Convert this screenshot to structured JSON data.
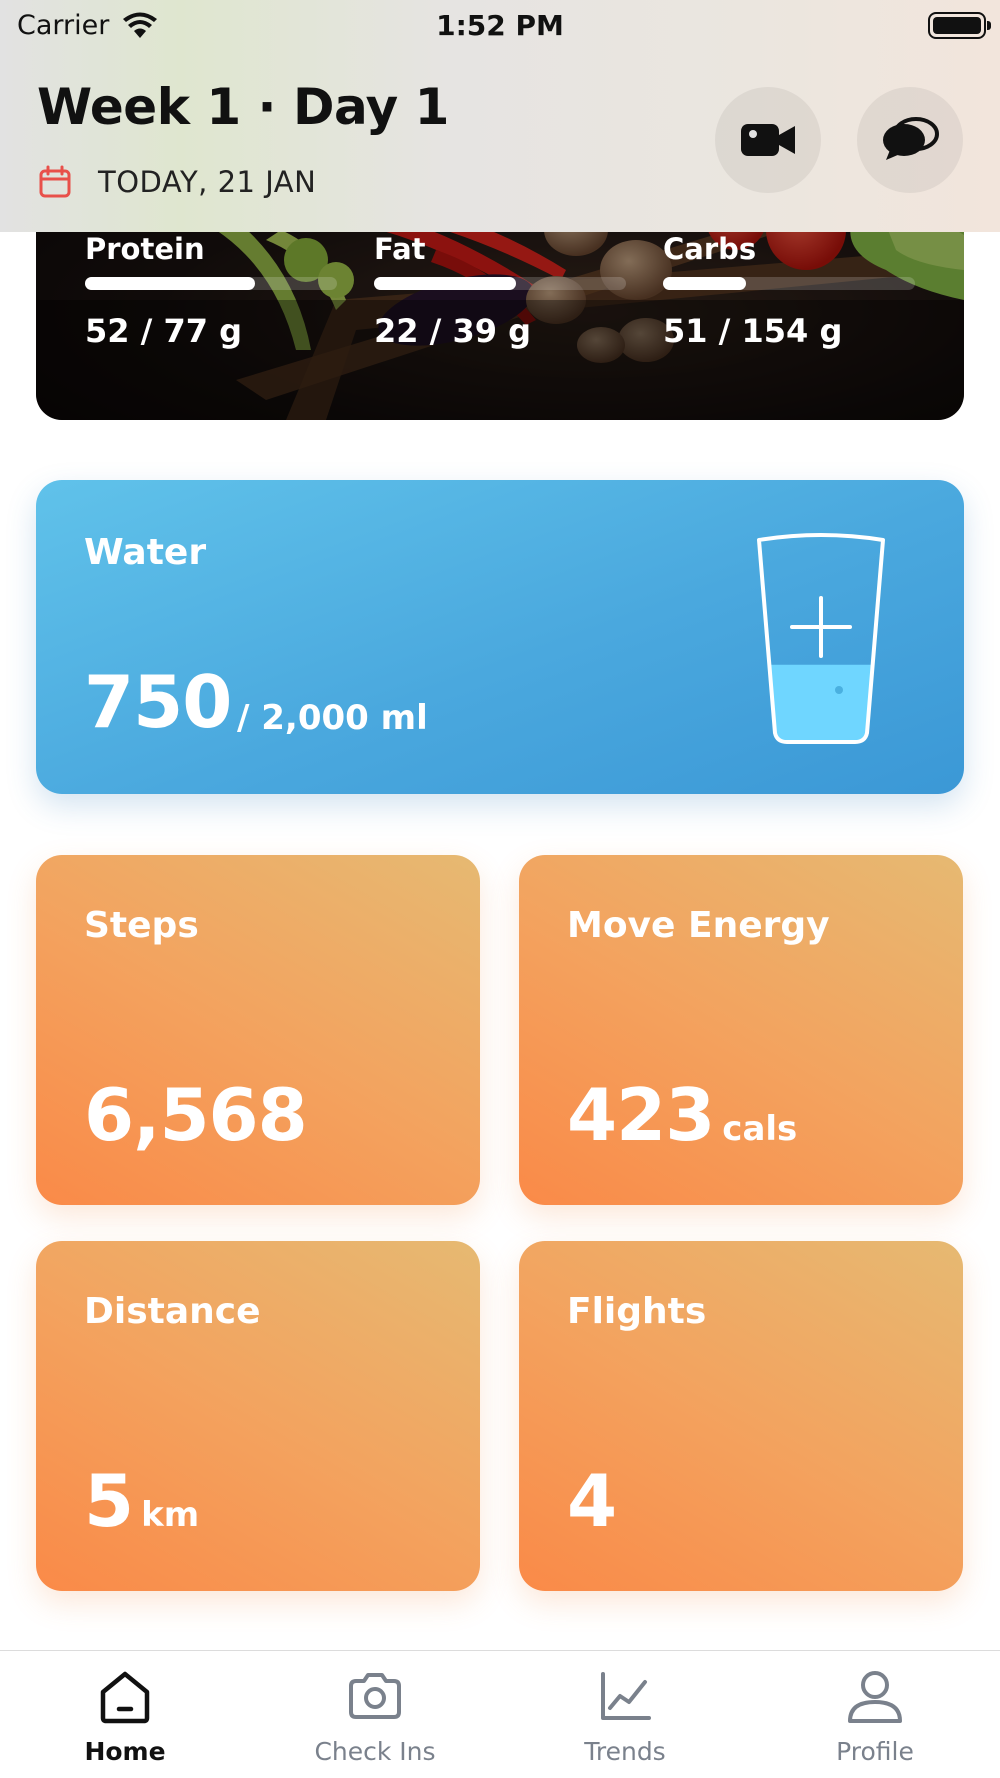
{
  "status_bar": {
    "carrier": "Carrier",
    "time": "1:52 PM",
    "icons": [
      "wifi-icon",
      "battery-icon"
    ]
  },
  "header": {
    "title": "Week 1 · Day 1",
    "date": "TODAY, 21 JAN",
    "buttons": {
      "video_icon": "video-camera-icon",
      "chat_icon": "chat-bubbles-icon"
    }
  },
  "macros": [
    {
      "label": "Protein",
      "value": "52 / 77 g",
      "progress": 0.675
    },
    {
      "label": "Fat",
      "value": "22 / 39 g",
      "progress": 0.564
    },
    {
      "label": "Carbs",
      "value": "51 / 154 g",
      "progress": 0.331
    }
  ],
  "water": {
    "title": "Water",
    "amount": "750",
    "goal": "/  2,000 ml",
    "fill_fraction": 0.375,
    "icon": "water-glass-plus-icon"
  },
  "activity": {
    "steps": {
      "title": "Steps",
      "value": "6,568",
      "unit": ""
    },
    "move_energy": {
      "title": "Move Energy",
      "value": "423",
      "unit": "cals"
    },
    "distance": {
      "title": "Distance",
      "value": "5",
      "unit": "km"
    },
    "flights": {
      "title": "Flights",
      "value": "4",
      "unit": ""
    }
  },
  "tabs": [
    {
      "label": "Home",
      "icon": "home-icon",
      "active": true
    },
    {
      "label": "Check Ins",
      "icon": "camera-icon",
      "active": false
    },
    {
      "label": "Trends",
      "icon": "trend-chart-icon",
      "active": false
    },
    {
      "label": "Profile",
      "icon": "person-icon",
      "active": false
    }
  ],
  "colors": {
    "water_card": "#4aa8de",
    "activity_card": "#f3a35f",
    "calendar_icon": "#e8504a",
    "tab_active": "#111111",
    "tab_inactive": "#7a818c"
  }
}
